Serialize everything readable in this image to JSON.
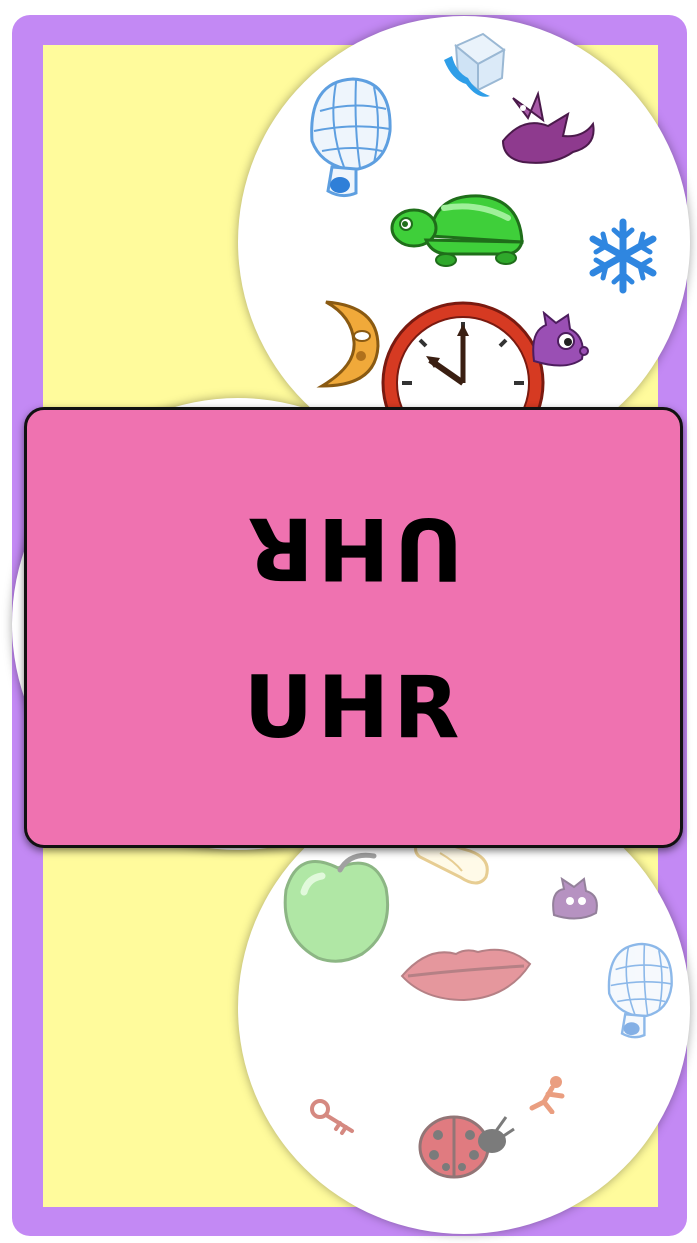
{
  "game": {
    "target_word": "Uhr",
    "target_word_flipped": "Uhr"
  },
  "cards": {
    "top": {
      "symbols": [
        "ice-cube",
        "igloo",
        "dragon",
        "turtle",
        "snowflake",
        "moon",
        "clock",
        "cat"
      ]
    },
    "bottom": {
      "symbols": [
        "apple",
        "light-bulb",
        "cat",
        "lips",
        "igloo",
        "key",
        "ladybug",
        "figure"
      ]
    }
  },
  "colors": {
    "frame": "#c389f4",
    "board": "#fffb9c",
    "banner": "#ef72b0",
    "text": "#000000"
  }
}
